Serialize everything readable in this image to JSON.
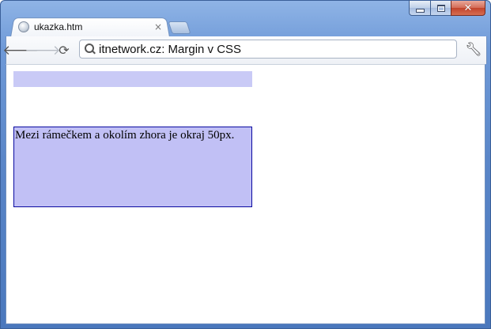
{
  "browser": {
    "tab": {
      "title": "ukazka.htm",
      "close_glyph": "×",
      "favicon": "globe-icon"
    },
    "new_tab_icon": "new-tab-icon",
    "caption": {
      "minimize_icon": "minimize-icon",
      "maximize_icon": "maximize-icon",
      "close_icon": "close-icon"
    },
    "toolbar": {
      "back_icon": "back-arrow-icon",
      "forward_icon": "forward-arrow-icon",
      "reload_icon": "reload-icon",
      "omnibox_icon": "search-icon",
      "url": "itnetwork.cz: Margin v CSS",
      "menu_icon": "wrench-icon"
    }
  },
  "page": {
    "box_text": "Mezi rámečkem a okolím zhora je okraj 50px."
  },
  "colors": {
    "frame": "#6f9ad8",
    "box_fill": "#c1c0f5",
    "box_border": "#0a0aa0",
    "top_box_fill": "#c9caf6"
  }
}
